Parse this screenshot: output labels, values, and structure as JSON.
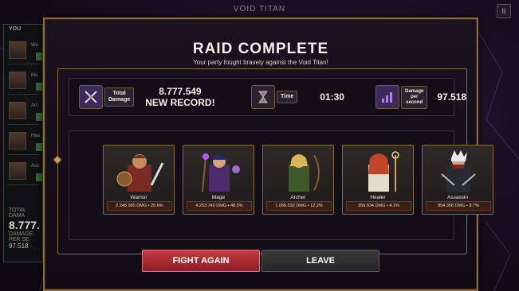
{
  "game": {
    "title": "VOID TITAN",
    "pause_glyph": "II"
  },
  "side_panel": {
    "header": "YOU",
    "rows": [
      {
        "label": "Wa"
      },
      {
        "label": "Ma"
      },
      {
        "label": "Arc"
      },
      {
        "label": "Hea"
      },
      {
        "label": "Ass"
      }
    ],
    "total_damage_label": "TOTAL DAMA",
    "total_damage_value": "8.777.",
    "dps_label": "DAMAGE PER SE",
    "dps_value": "97.518"
  },
  "modal": {
    "title": "RAID COMPLETE",
    "subtitle": "Your party fought bravely against the Void Titan!",
    "stats": {
      "total_damage": {
        "label": "Total\nDamage",
        "value": "8.777.549",
        "note": "NEW RECORD!"
      },
      "time": {
        "label": "Time",
        "value": "01:30"
      },
      "dps": {
        "label": "Damage\nper\nsecond",
        "value": "97.518"
      }
    },
    "heroes": [
      {
        "name": "Warrior",
        "stat": "2.245.985 DMG • 25.6%"
      },
      {
        "name": "Mage",
        "stat": "4.253.740 DMG • 48.5%"
      },
      {
        "name": "Archer",
        "stat": "1.066.532 DMG • 12.2%"
      },
      {
        "name": "Healer",
        "stat": "356.934 DMG • 4.1%"
      },
      {
        "name": "Assassin",
        "stat": "854.358 DMG • 9.7%"
      }
    ],
    "buttons": {
      "fight_again": "FIGHT AGAIN",
      "leave": "LEAVE"
    }
  },
  "colors": {
    "accent_gold": "#caa15c",
    "button_red": "#c23a40",
    "button_gray": "#3a3a3a",
    "background": "#1c0f25"
  }
}
